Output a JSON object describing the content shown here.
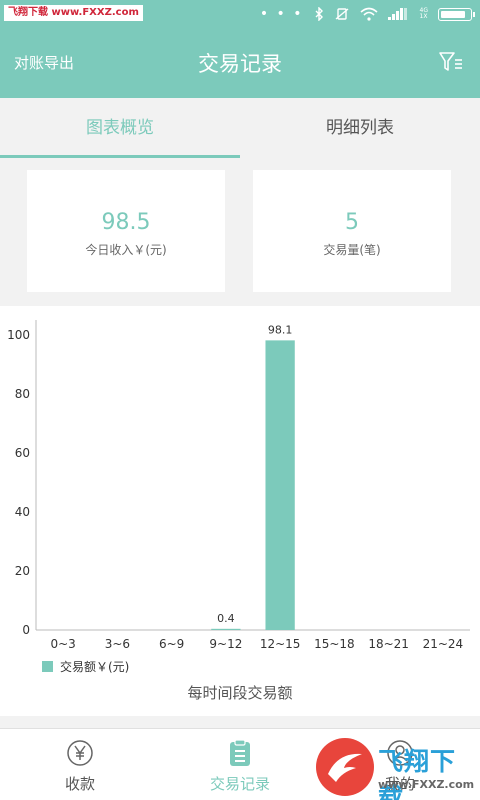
{
  "statusbar": {
    "watermark_text": "飞翔下载 www.FXXZ.com",
    "dots": "• • •",
    "net_4g": "4G",
    "net_1x": "1X",
    "battery_level": 0.9
  },
  "header": {
    "export_label": "对账导出",
    "title": "交易记录"
  },
  "tabs": [
    {
      "label": "图表概览",
      "active": true
    },
    {
      "label": "明细列表",
      "active": false
    }
  ],
  "summary": {
    "income": {
      "value": "98.5",
      "label": "今日收入￥(元)"
    },
    "count": {
      "value": "5",
      "label": "交易量(笔)"
    }
  },
  "colors": {
    "accent": "#7ccabb",
    "background": "#f2f2f2"
  },
  "chart_data": {
    "type": "bar",
    "categories": [
      "0~3",
      "3~6",
      "6~9",
      "9~12",
      "12~15",
      "15~18",
      "18~21",
      "21~24"
    ],
    "series": [
      {
        "name": "交易额￥(元)",
        "values": [
          0,
          0,
          0,
          0.4,
          98.1,
          0,
          0,
          0
        ],
        "color": "#7ccabb"
      }
    ],
    "data_labels": [
      "",
      "",
      "",
      "0.4",
      "98.1",
      "",
      "",
      ""
    ],
    "yticks": [
      "0",
      "20",
      "40",
      "60",
      "80",
      "100"
    ],
    "ylim": [
      0,
      105
    ],
    "title": "每时间段交易额",
    "legend": "bottom-left",
    "grid": false
  },
  "nav": {
    "items": [
      {
        "label": "收款",
        "icon": "yen-circle-icon",
        "active": false
      },
      {
        "label": "交易记录",
        "icon": "clipboard-icon",
        "active": true
      },
      {
        "label": "我的",
        "icon": "user-icon",
        "active": false
      }
    ]
  },
  "overlay": {
    "brand": "飞翔下载",
    "url": "www.FXXZ.com"
  }
}
